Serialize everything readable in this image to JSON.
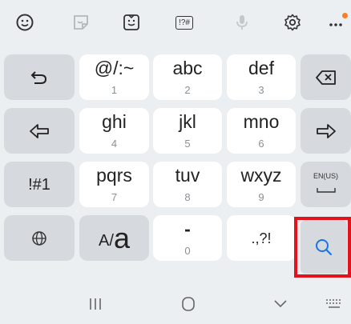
{
  "toolbar": {
    "icons": [
      "emoji-icon",
      "sticker-icon",
      "bitmoji-icon",
      "symbols-icon",
      "mic-icon",
      "settings-icon",
      "more-icon"
    ],
    "symbols_label": "!?#"
  },
  "keys": {
    "undo": {
      "icon": "undo-icon"
    },
    "punct": {
      "main": "@/:~",
      "sub": "1"
    },
    "abc": {
      "main": "abc",
      "sub": "2"
    },
    "def": {
      "main": "def",
      "sub": "3"
    },
    "backspace": {
      "icon": "backspace-icon"
    },
    "left": {
      "icon": "arrow-left-icon"
    },
    "ghi": {
      "main": "ghi",
      "sub": "4"
    },
    "jkl": {
      "main": "jkl",
      "sub": "5"
    },
    "mno": {
      "main": "mno",
      "sub": "6"
    },
    "right": {
      "icon": "arrow-right-icon"
    },
    "symbols": {
      "main": "!#1"
    },
    "pqrs": {
      "main": "pqrs",
      "sub": "7"
    },
    "tuv": {
      "main": "tuv",
      "sub": "8"
    },
    "wxyz": {
      "main": "wxyz",
      "sub": "9"
    },
    "language": {
      "main": "EN(US)"
    },
    "globe": {
      "icon": "globe-icon"
    },
    "case": {
      "small": "A/",
      "big": "a"
    },
    "space": {
      "main": "-",
      "sub": "0"
    },
    "punct2": {
      "main": ".,?!"
    },
    "search": {
      "icon": "search-icon"
    }
  },
  "nav": {
    "icons": [
      "recents-icon",
      "home-icon",
      "back-icon",
      "keyboard-icon"
    ]
  },
  "colors": {
    "accent": "#1a73e8",
    "highlight": "#e3121c",
    "badge": "#ff7b1c"
  }
}
